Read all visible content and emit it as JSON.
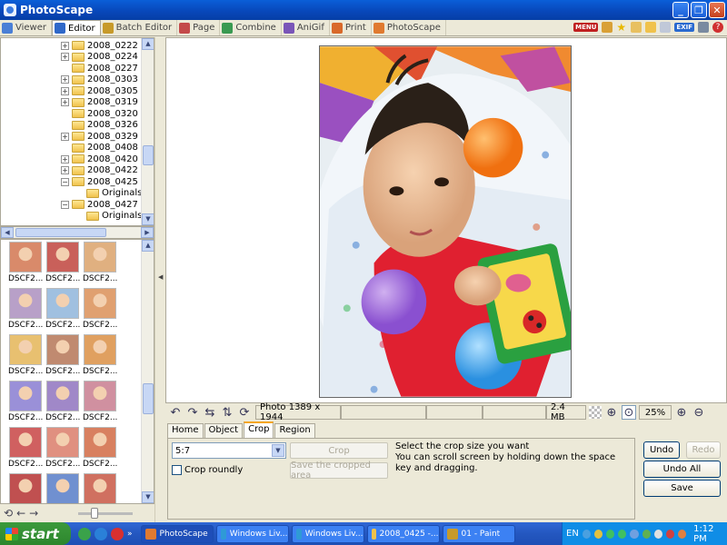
{
  "window": {
    "title": "PhotoScape"
  },
  "main_tabs": [
    {
      "label": "Viewer",
      "active": false,
      "color": "#4a7fd6"
    },
    {
      "label": "Editor",
      "active": true,
      "color": "#2f68c9"
    },
    {
      "label": "Batch Editor",
      "active": false,
      "color": "#c79a2a"
    },
    {
      "label": "Page",
      "active": false,
      "color": "#c44a4a"
    },
    {
      "label": "Combine",
      "active": false,
      "color": "#3a9a52"
    },
    {
      "label": "AniGif",
      "active": false,
      "color": "#7a55b8"
    },
    {
      "label": "Print",
      "active": false,
      "color": "#d9692a"
    },
    {
      "label": "PhotoScape",
      "active": false,
      "color": "#e07a30"
    }
  ],
  "toolbar_right": {
    "menu_label": "MENU",
    "exif_label": "EXIF"
  },
  "folder_tree": [
    {
      "name": "2008_0222",
      "expander": "+",
      "indent": 0
    },
    {
      "name": "2008_0224",
      "expander": "+",
      "indent": 0
    },
    {
      "name": "2008_0227",
      "expander": "",
      "indent": 0
    },
    {
      "name": "2008_0303",
      "expander": "+",
      "indent": 0
    },
    {
      "name": "2008_0305",
      "expander": "+",
      "indent": 0
    },
    {
      "name": "2008_0319",
      "expander": "+",
      "indent": 0
    },
    {
      "name": "2008_0320",
      "expander": "",
      "indent": 0
    },
    {
      "name": "2008_0326",
      "expander": "",
      "indent": 0
    },
    {
      "name": "2008_0329",
      "expander": "+",
      "indent": 0
    },
    {
      "name": "2008_0408",
      "expander": "",
      "indent": 0
    },
    {
      "name": "2008_0420",
      "expander": "+",
      "indent": 0
    },
    {
      "name": "2008_0422",
      "expander": "+",
      "indent": 0
    },
    {
      "name": "2008_0425",
      "expander": "−",
      "indent": 0
    },
    {
      "name": "Originals",
      "expander": "",
      "indent": 1
    },
    {
      "name": "2008_0427",
      "expander": "−",
      "indent": 0
    },
    {
      "name": "Originals",
      "expander": "",
      "indent": 1
    }
  ],
  "thumbnails": {
    "label": "DSCF2...",
    "colors": [
      "#d98a6a",
      "#c9605a",
      "#e0b080",
      "#b8a0c8",
      "#a0c0e0",
      "#e0a070",
      "#e8c070",
      "#c08a70",
      "#e0a060",
      "#9a90d8",
      "#a088c8",
      "#d090a0",
      "#d06060",
      "#e09080",
      "#d88060",
      "#c05050",
      "#7090d0",
      "#d07060"
    ]
  },
  "status": {
    "photo_info": "Photo 1389 x 1944",
    "file_size": "2.4 MB",
    "zoom": "25%"
  },
  "edit_tabs": [
    {
      "label": "Home",
      "active": false
    },
    {
      "label": "Object",
      "active": false
    },
    {
      "label": "Crop",
      "active": true
    },
    {
      "label": "Region",
      "active": false
    }
  ],
  "crop": {
    "ratio_value": "5:7",
    "crop_button": "Crop",
    "crop_round_label": "Crop roundly",
    "save_cropped_label": "Save the cropped area",
    "help_text": "Select the crop size you want\nYou can scroll screen by holding down the space key and dragging."
  },
  "actions": {
    "undo": "Undo",
    "redo": "Redo",
    "undo_all": "Undo All",
    "save": "Save"
  },
  "taskbar": {
    "start_label": "start",
    "tasks": [
      {
        "label": "PhotoScape",
        "active": true,
        "color": "#e07a30"
      },
      {
        "label": "Windows Liv...",
        "active": false,
        "color": "#2f9ad6"
      },
      {
        "label": "Windows Liv...",
        "active": false,
        "color": "#2f9ad6"
      },
      {
        "label": "2008_0425 -...",
        "active": false,
        "color": "#f0c24c"
      },
      {
        "label": "01 - Paint",
        "active": false,
        "color": "#c79a2a"
      }
    ],
    "tray_lang": "EN",
    "clock": "1:12 PM"
  }
}
